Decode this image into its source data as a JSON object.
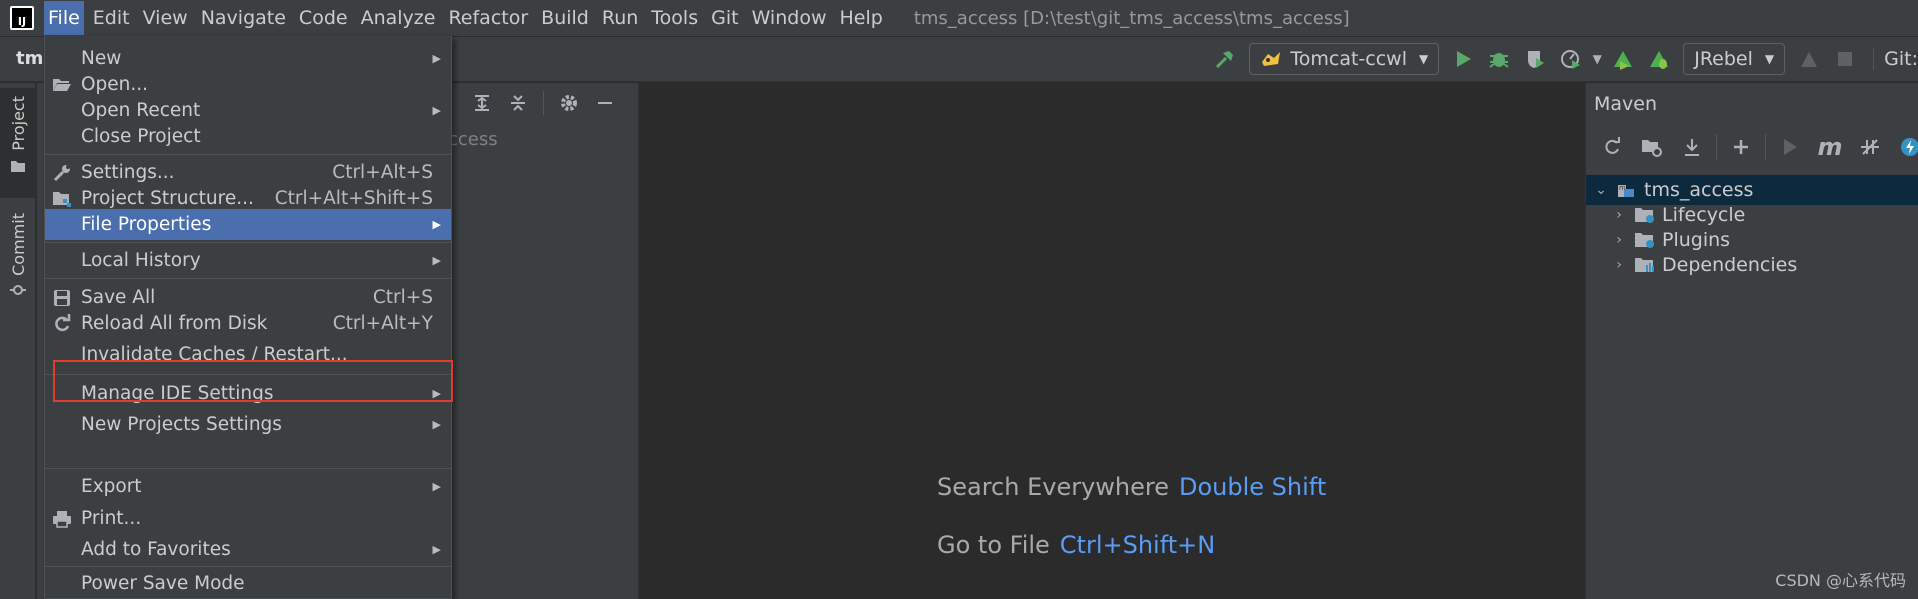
{
  "menubar": {
    "items": [
      "File",
      "Edit",
      "View",
      "Navigate",
      "Code",
      "Analyze",
      "Refactor",
      "Build",
      "Run",
      "Tools",
      "Git",
      "Window",
      "Help"
    ],
    "window_title": "tms_access [D:\\test\\git_tms_access\\tms_access]"
  },
  "toolbar": {
    "breadcrumb": "tm",
    "run_config": "Tomcat-ccwl",
    "jrebel": "JRebel",
    "git_label": "Git:"
  },
  "stripe": {
    "project": "Project",
    "commit": "Commit"
  },
  "project_panel": {
    "tree_text": "ccess"
  },
  "file_menu": {
    "items": [
      {
        "label": "New",
        "shortcut": "",
        "submenu": true,
        "icon": ""
      },
      {
        "label": "Open...",
        "shortcut": "",
        "submenu": false,
        "icon": "folder-open-icon"
      },
      {
        "label": "Open Recent",
        "shortcut": "",
        "submenu": true,
        "icon": ""
      },
      {
        "label": "Close Project",
        "shortcut": "",
        "submenu": false,
        "icon": ""
      },
      {
        "label": "Settings...",
        "shortcut": "Ctrl+Alt+S",
        "submenu": false,
        "icon": "wrench-icon"
      },
      {
        "label": "Project Structure...",
        "shortcut": "Ctrl+Alt+Shift+S",
        "submenu": false,
        "icon": "project-structure-icon"
      },
      {
        "label": "File Properties",
        "shortcut": "",
        "submenu": true,
        "icon": "",
        "highlighted": true
      },
      {
        "label": "Local History",
        "shortcut": "",
        "submenu": true,
        "icon": ""
      },
      {
        "label": "Save All",
        "shortcut": "Ctrl+S",
        "submenu": false,
        "icon": "save-icon"
      },
      {
        "label": "Reload All from Disk",
        "shortcut": "Ctrl+Alt+Y",
        "submenu": false,
        "icon": "reload-icon"
      },
      {
        "label": "Invalidate Caches / Restart...",
        "shortcut": "",
        "submenu": false,
        "icon": ""
      },
      {
        "label": "Manage IDE Settings",
        "shortcut": "",
        "submenu": true,
        "icon": ""
      },
      {
        "label": "New Projects Settings",
        "shortcut": "",
        "submenu": true,
        "icon": ""
      },
      {
        "label": "Export",
        "shortcut": "",
        "submenu": true,
        "icon": ""
      },
      {
        "label": "Print...",
        "shortcut": "",
        "submenu": false,
        "icon": "print-icon"
      },
      {
        "label": "Add to Favorites",
        "shortcut": "",
        "submenu": true,
        "icon": ""
      },
      {
        "label": "Power Save Mode",
        "shortcut": "",
        "submenu": false,
        "icon": ""
      }
    ]
  },
  "editor": {
    "hints": [
      {
        "label": "Search Everywhere",
        "key": "Double Shift"
      },
      {
        "label": "Go to File",
        "key": "Ctrl+Shift+N"
      }
    ]
  },
  "maven": {
    "title": "Maven",
    "root": "tms_access",
    "children": [
      "Lifecycle",
      "Plugins",
      "Dependencies"
    ]
  },
  "watermark": "CSDN @心系代码",
  "colors": {
    "accent": "#4b6eaf",
    "highlight_box": "#e03c31",
    "link": "#589df6",
    "run_green": "#59a869"
  }
}
